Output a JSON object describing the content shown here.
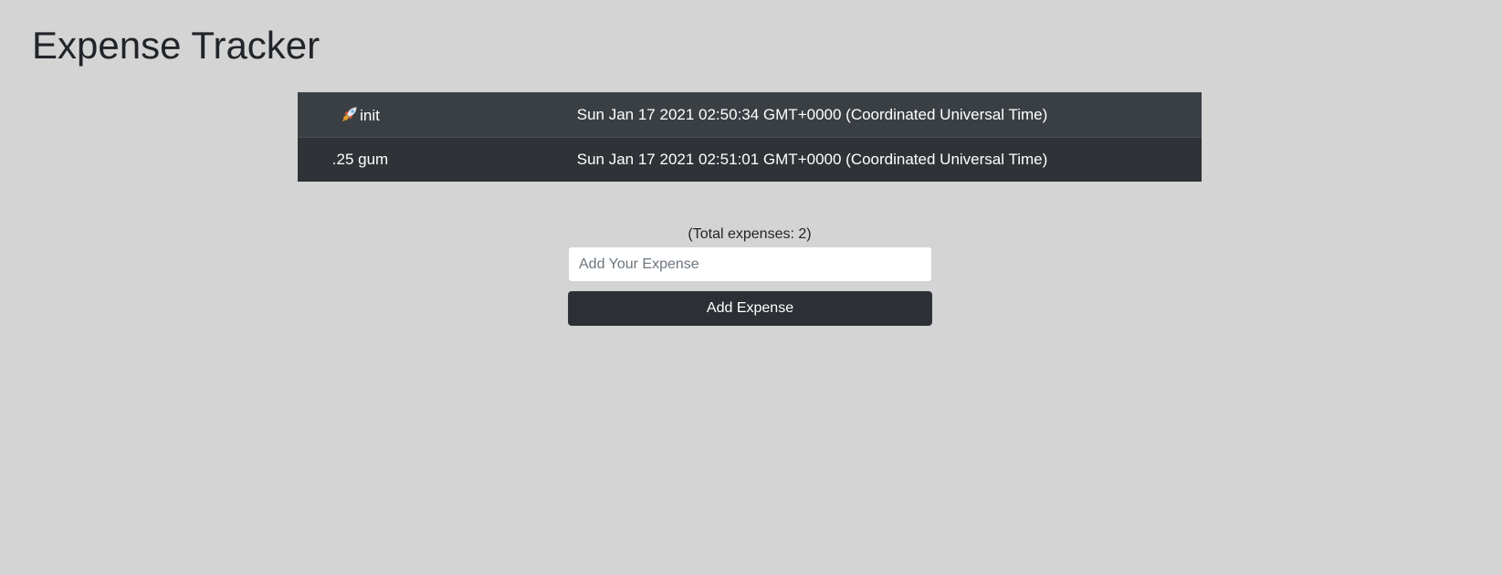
{
  "page": {
    "title": "Expense Tracker"
  },
  "expenses": [
    {
      "name": "init",
      "icon": "rocket-icon",
      "date": "Sun Jan 17 2021 02:50:34 GMT+0000 (Coordinated Universal Time)"
    },
    {
      "name": ".25 gum",
      "date": "Sun Jan 17 2021 02:51:01 GMT+0000 (Coordinated Universal Time)"
    }
  ],
  "summary": {
    "total_text": "(Total expenses: 2)"
  },
  "form": {
    "input_value": "",
    "input_placeholder": "Add Your Expense",
    "button_label": "Add Expense"
  },
  "colors": {
    "background": "#d4d4d4",
    "table_row_odd": "#3a3f44",
    "table_row_even": "#2f3338",
    "button": "#2c3035"
  }
}
